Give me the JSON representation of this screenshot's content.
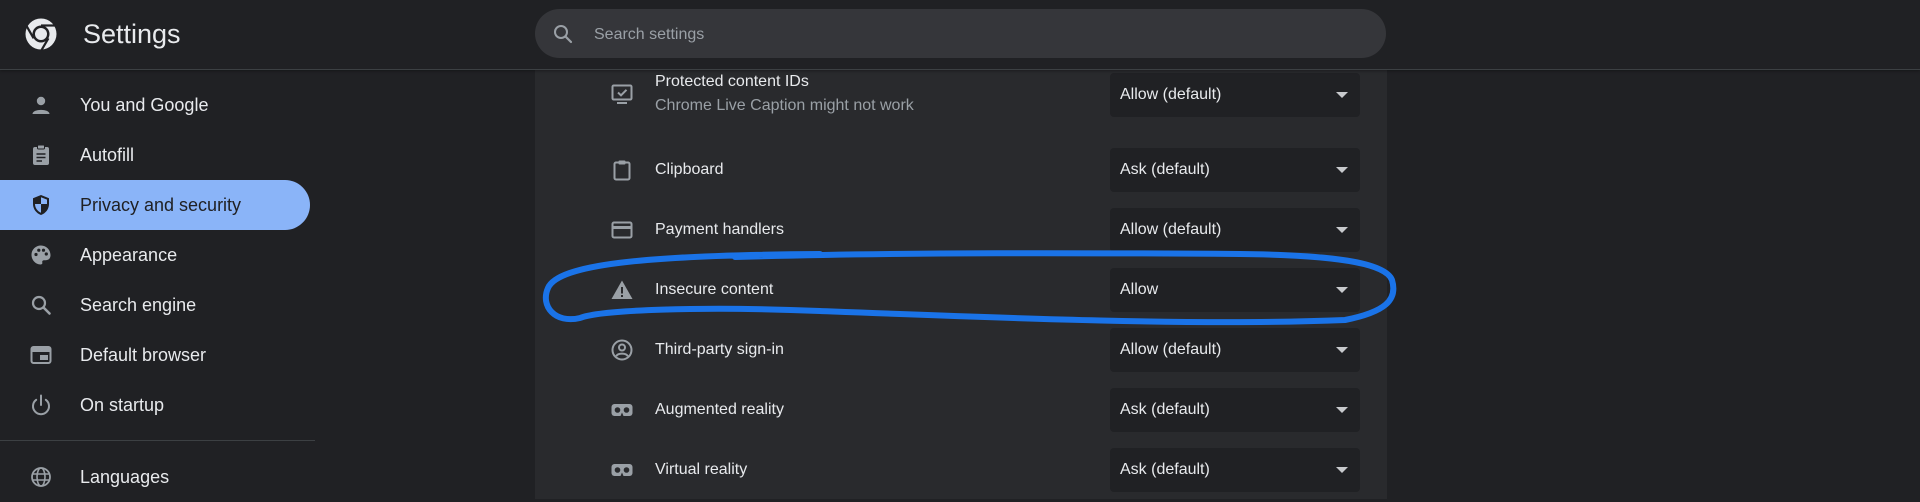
{
  "header": {
    "title": "Settings",
    "logo_icon": "chrome-logo-icon",
    "search": {
      "placeholder": "Search settings",
      "value": ""
    }
  },
  "sidebar": {
    "items": [
      {
        "label": "You and Google",
        "icon": "person-icon",
        "active": false
      },
      {
        "label": "Autofill",
        "icon": "clipboard-list-icon",
        "active": false
      },
      {
        "label": "Privacy and security",
        "icon": "shield-icon",
        "active": true
      },
      {
        "label": "Appearance",
        "icon": "palette-icon",
        "active": false
      },
      {
        "label": "Search engine",
        "icon": "search-icon",
        "active": false
      },
      {
        "label": "Default browser",
        "icon": "browser-window-icon",
        "active": false
      },
      {
        "label": "On startup",
        "icon": "power-icon",
        "active": false
      },
      {
        "label": "Languages",
        "icon": "globe-icon",
        "active": false
      }
    ]
  },
  "content": {
    "rows": [
      {
        "title": "Protected content IDs",
        "subtitle": "Chrome Live Caption might not work",
        "icon": "monitor-check-icon",
        "value": "Allow (default)"
      },
      {
        "title": "Clipboard",
        "icon": "clipboard-icon",
        "value": "Ask (default)"
      },
      {
        "title": "Payment handlers",
        "icon": "credit-card-icon",
        "value": "Allow (default)"
      },
      {
        "title": "Insecure content",
        "icon": "warning-icon",
        "value": "Allow",
        "highlighted": true
      },
      {
        "title": "Third-party sign-in",
        "icon": "account-circle-icon",
        "value": "Allow (default)"
      },
      {
        "title": "Augmented reality",
        "icon": "vr-headset-icon",
        "value": "Ask (default)"
      },
      {
        "title": "Virtual reality",
        "icon": "vr-headset-icon",
        "value": "Ask (default)"
      }
    ]
  },
  "colors": {
    "background": "#202124",
    "card": "#292a2d",
    "active_nav": "#8ab4f8",
    "annotation": "#1a73e8"
  }
}
